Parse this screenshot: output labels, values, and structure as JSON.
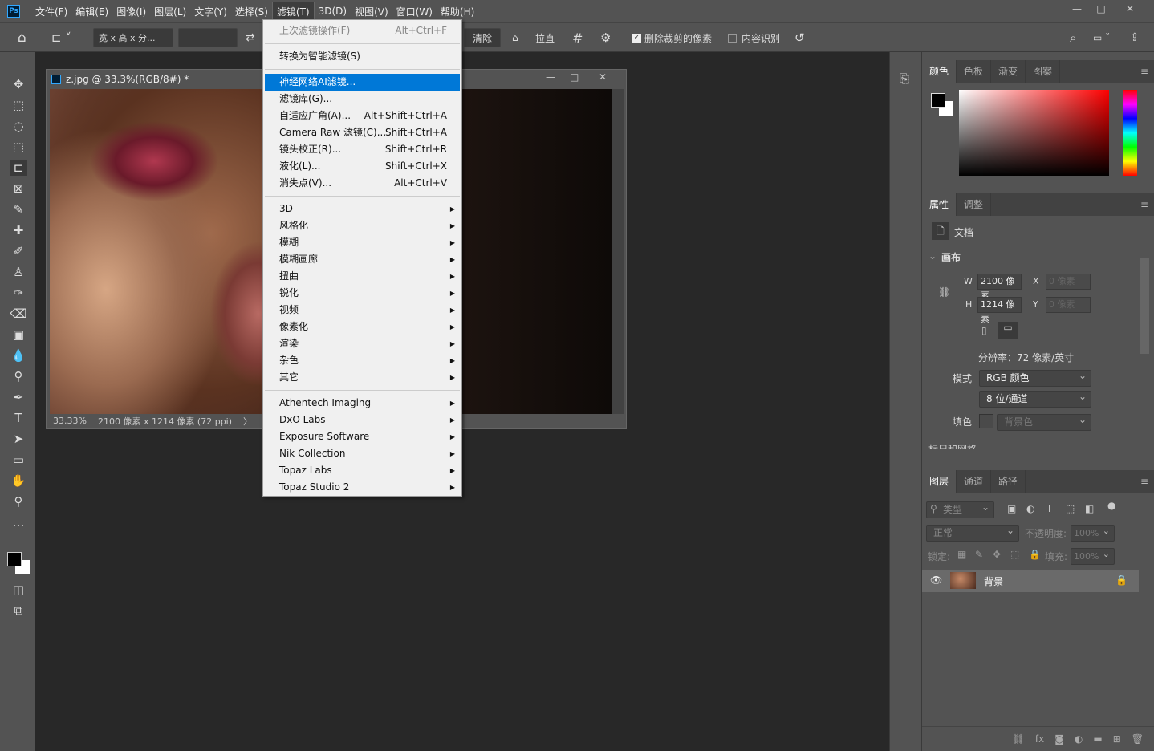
{
  "app": {
    "logo": "Ps"
  },
  "menubar": {
    "items": [
      "文件(F)",
      "编辑(E)",
      "图像(I)",
      "图层(L)",
      "文字(Y)",
      "选择(S)",
      "滤镜(T)",
      "3D(D)",
      "视图(V)",
      "窗口(W)",
      "帮助(H)"
    ],
    "active_index": 6
  },
  "window_controls": {
    "minimize": "—",
    "restore": "□",
    "close": "✕"
  },
  "options": {
    "ratio": "宽 x 高 x 分...",
    "ratio_value": "",
    "clear": "清除",
    "straighten": "拉直",
    "delete_cropped_label": "删除裁剪的像素",
    "delete_cropped_checked": true,
    "content_aware_label": "内容识别",
    "content_aware_checked": false
  },
  "document": {
    "title": "z.jpg @ 33.3%(RGB/8#) *",
    "zoom": "33.33%",
    "info": "2100 像素 x 1214 像素 (72 ppi)",
    "arrow": "〉"
  },
  "filter_menu": {
    "top": [
      {
        "label": "上次滤镜操作(F)",
        "shortcut": "Alt+Ctrl+F",
        "disabled": true
      }
    ],
    "convert": "转换为智能滤镜(S)",
    "main": [
      {
        "label": "神经网络AI滤镜...",
        "shortcut": "",
        "highlighted": true
      },
      {
        "label": "滤镜库(G)...",
        "shortcut": ""
      },
      {
        "label": "自适应广角(A)...",
        "shortcut": "Alt+Shift+Ctrl+A"
      },
      {
        "label": "Camera Raw 滤镜(C)...",
        "shortcut": "Shift+Ctrl+A"
      },
      {
        "label": "镜头校正(R)...",
        "shortcut": "Shift+Ctrl+R"
      },
      {
        "label": "液化(L)...",
        "shortcut": "Shift+Ctrl+X"
      },
      {
        "label": "消失点(V)...",
        "shortcut": "Alt+Ctrl+V"
      }
    ],
    "submenus": [
      "3D",
      "风格化",
      "模糊",
      "模糊画廊",
      "扭曲",
      "锐化",
      "视频",
      "像素化",
      "渲染",
      "杂色",
      "其它"
    ],
    "plugins": [
      "Athentech Imaging",
      "DxO Labs",
      "Exposure Software",
      "Nik Collection",
      "Topaz Labs",
      "Topaz Studio 2"
    ]
  },
  "color_panel": {
    "tabs": [
      "颜色",
      "色板",
      "渐变",
      "图案"
    ],
    "foreground": "#000000",
    "background": "#ffffff",
    "hue": "#ff0000"
  },
  "properties": {
    "tabs": [
      "属性",
      "调整"
    ],
    "doc_label": "文档",
    "section": "画布",
    "w_label": "W",
    "w_value": "2100 像素",
    "h_label": "H",
    "h_value": "1214 像素",
    "x_label": "X",
    "x_value": "0 像素",
    "y_label": "Y",
    "y_value": "0 像素",
    "resolution": "分辨率：72 像素/英寸",
    "mode_label": "模式",
    "mode": "RGB 颜色",
    "depth": "8 位/通道",
    "fill_label": "填色",
    "fill": "背景色",
    "next_section": "标尺和网格"
  },
  "layers": {
    "tabs": [
      "图层",
      "通道",
      "路径"
    ],
    "filter": "类型",
    "blend": "正常",
    "opacity_label": "不透明度:",
    "opacity": "100%",
    "lock_label": "锁定:",
    "fill_label": "填充:",
    "fill": "100%",
    "items": [
      {
        "name": "背景",
        "visible": true,
        "locked": true
      }
    ]
  }
}
